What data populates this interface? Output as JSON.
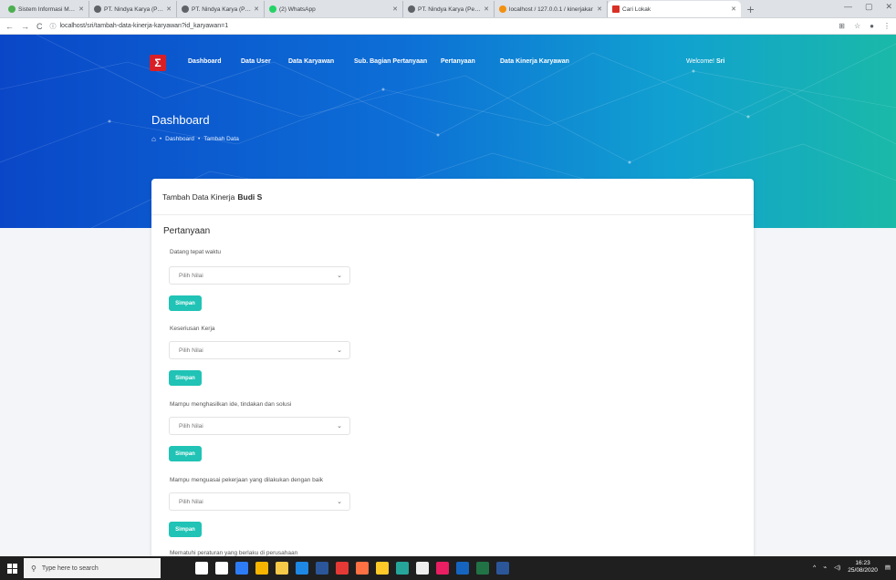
{
  "browser": {
    "tabs": [
      {
        "title": "Sistem Informasi Manajemen",
        "color": "#4caf50",
        "active": false
      },
      {
        "title": "PT. Nindya Karya (Persero) | SI",
        "color": "#5f6368",
        "active": false
      },
      {
        "title": "PT. Nindya Karya (Persero) | SI",
        "color": "#5f6368",
        "active": true
      },
      {
        "title": "(2) WhatsApp",
        "color": "#25d366",
        "active": false
      },
      {
        "title": "PT. Nindya Karya (Persero) | SI",
        "color": "#5f6368",
        "active": false
      },
      {
        "title": "localhost / 127.0.0.1 / kinerjakar",
        "color": "#f29111",
        "active": false
      },
      {
        "title": "Cari Lokak",
        "color": "#d93025",
        "active": false
      }
    ],
    "url": "localhost/sri/tambah-data-kinerja-karyawan?id_karyawan=1"
  },
  "nav": {
    "logo_letter": "Σ",
    "items": [
      "Dashboard",
      "Data User",
      "Data Karyawan",
      "Sub. Bagian Pertanyaan",
      "Pertanyaan",
      "Data Kinerja Karyawan"
    ],
    "welcome_label": "Welcome!",
    "welcome_user": "Sri"
  },
  "header": {
    "title": "Dashboard",
    "breadcrumb": [
      "Dashboard",
      "Tambah Data"
    ]
  },
  "card": {
    "title_prefix": "Tambah Data Kinerja",
    "title_name": "Budi S",
    "section": "Pertanyaan",
    "questions": [
      {
        "label": "Datang tepat waktu",
        "select": "Pilih Nilai",
        "button": "Simpan"
      },
      {
        "label": "Keseriusan Kerja",
        "select": "Pilih Nilai",
        "button": "Simpan"
      },
      {
        "label": "Mampu menghasilkan ide, tindakan dan solusi",
        "select": "Pilih Nilai",
        "button": "Simpan"
      },
      {
        "label": "Mampu menguasai pekerjaan yang dilakukan dengan baik",
        "select": "Pilih Nilai",
        "button": "Simpan"
      },
      {
        "label": "Mematuhi peraturan yang berlaku di perusahaan",
        "select": "",
        "button": ""
      }
    ]
  },
  "taskbar": {
    "search_placeholder": "Type here to search",
    "time": "16:23",
    "date": "25/08/2020",
    "icons": [
      "#ffffff",
      "#ffffff",
      "#2d7cf6",
      "#f7b500",
      "#f7c948",
      "#1e88e5",
      "#2b579a",
      "#e53935",
      "#ff7043",
      "#ffca28",
      "#26a69a",
      "#eeeeee",
      "#e91e63",
      "#1565c0",
      "#217346",
      "#2b579a"
    ]
  },
  "colors": {
    "accent_button": "#20c3b5",
    "hero_start": "#0a47c8",
    "hero_end": "#1ab9a8",
    "logo": "#d81f26"
  }
}
